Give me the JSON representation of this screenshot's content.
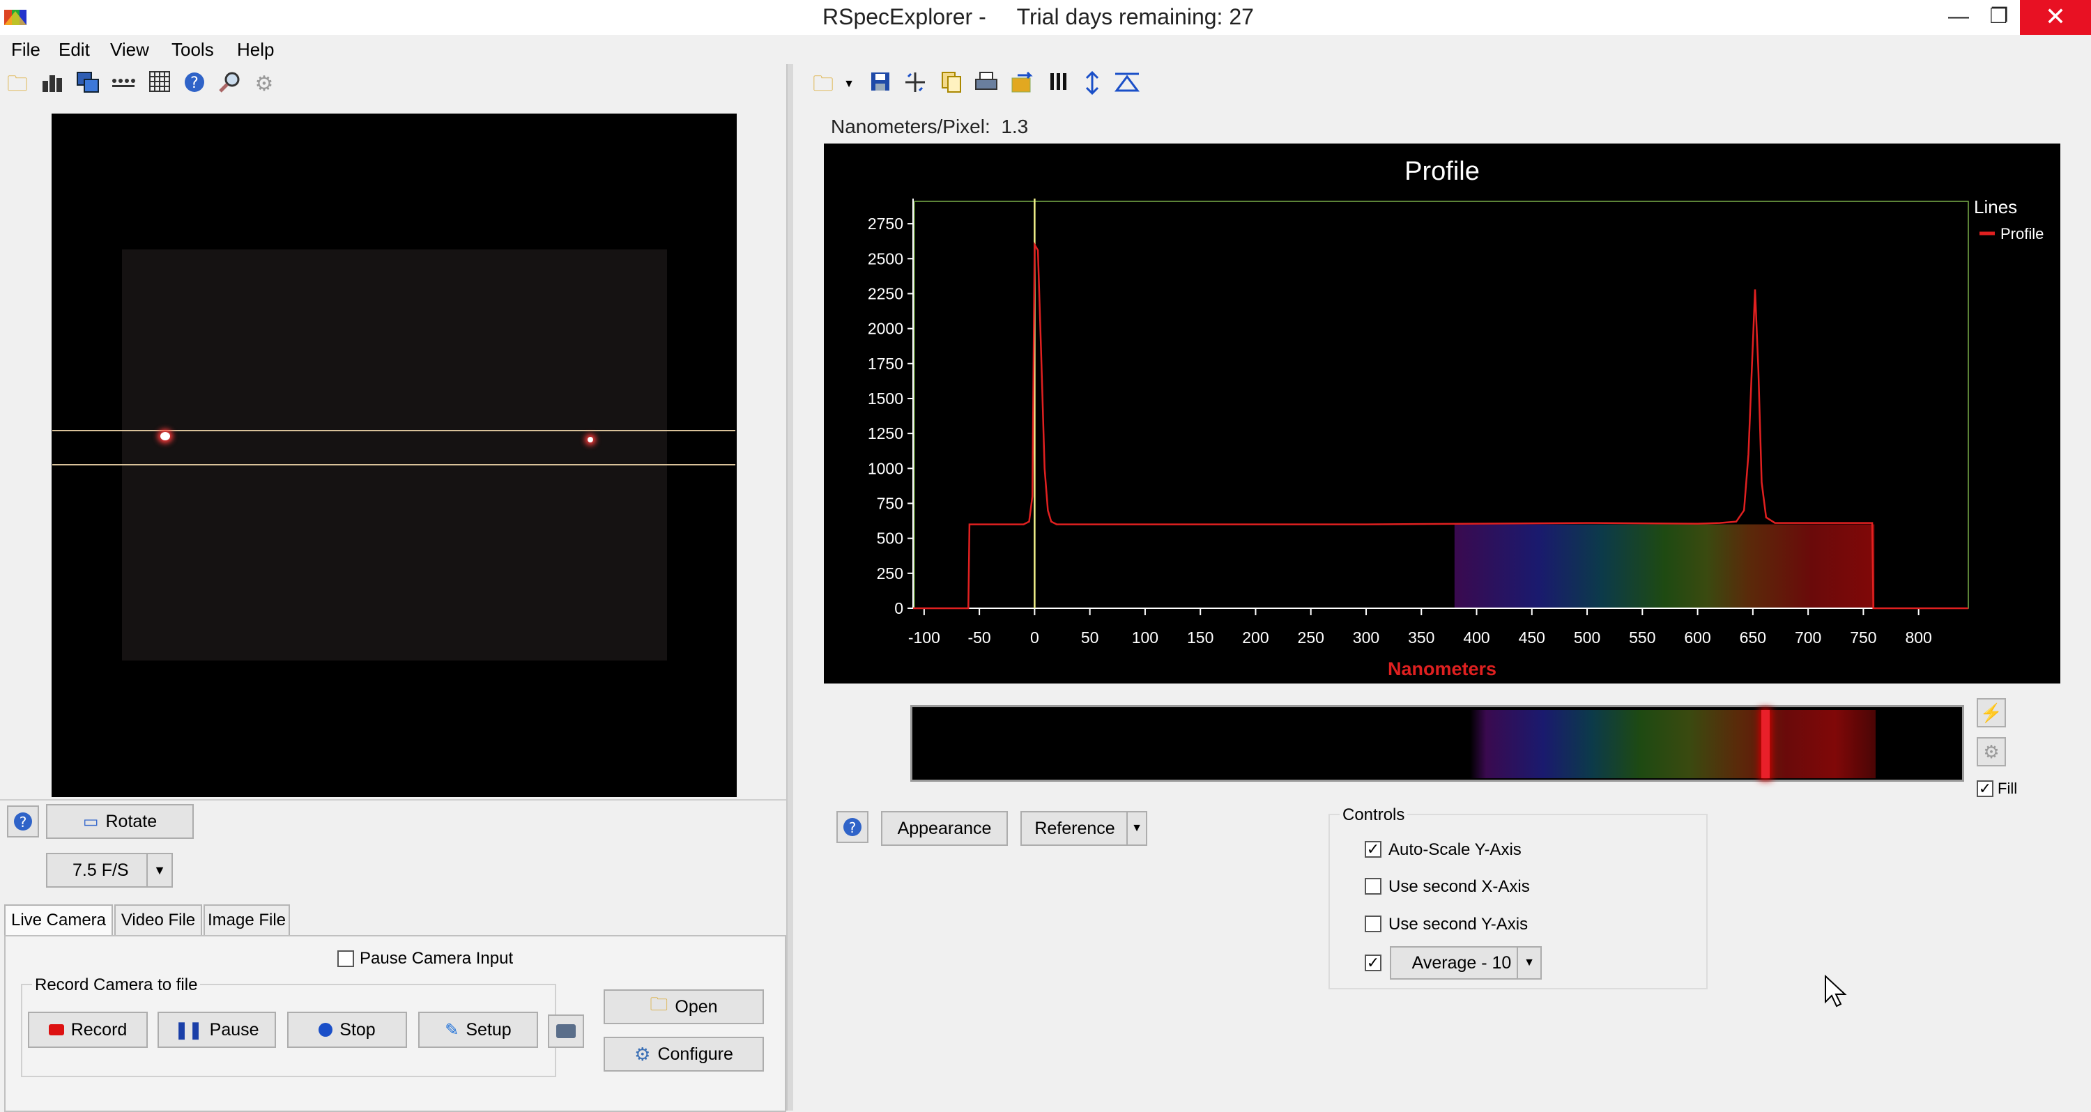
{
  "window": {
    "title": "RSpecExplorer -     Trial days remaining: 27",
    "minimize": "—",
    "restore": "❐",
    "close": "✕"
  },
  "menu": [
    "File",
    "Edit",
    "View",
    "Tools",
    "Help"
  ],
  "left_toolbar_icons": [
    "open-folder-icon",
    "bar-chart-icon",
    "copy-images-icon",
    "dots-icon",
    "grid-icon",
    "help-icon",
    "zoom-icon",
    "settings-icon"
  ],
  "right_toolbar_icons": [
    "open-folder-icon",
    "dropdown-arrow-icon",
    "save-icon",
    "crosshair-icon",
    "copy-icon",
    "print-icon",
    "export-icon",
    "columns-icon",
    "vertical-scale-icon",
    "triangle-icon"
  ],
  "camera_controls": {
    "rotate_label": "Rotate",
    "fps_value": "7.5 F/S"
  },
  "tabs": [
    "Live Camera",
    "Video File",
    "Image File"
  ],
  "pause_camera_label": "Pause Camera Input",
  "record_group": {
    "title": "Record Camera to file",
    "record": "Record",
    "pause": "Pause",
    "stop": "Stop",
    "setup": "Setup"
  },
  "file_buttons": {
    "open": "Open",
    "configure": "Configure"
  },
  "nm_per_pixel": "Nanometers/Pixel:  1.3",
  "chart_data": {
    "type": "line",
    "title": "Profile",
    "xlabel": "Nanometers",
    "ylabel": "",
    "xlim": [
      -110,
      845
    ],
    "ylim": [
      0,
      2900
    ],
    "x_ticks": [
      -100,
      -50,
      0,
      50,
      100,
      150,
      200,
      250,
      300,
      350,
      400,
      450,
      500,
      550,
      600,
      650,
      700,
      750,
      800
    ],
    "y_ticks": [
      0,
      250,
      500,
      750,
      1000,
      1250,
      1500,
      1750,
      2000,
      2250,
      2500,
      2750
    ],
    "legend_title": "Lines",
    "legend_placement": "top-right",
    "series": [
      {
        "name": "Profile",
        "color": "#e02020",
        "x": [
          -110,
          -60,
          -59,
          -10,
          -5,
          -2,
          0,
          3,
          6,
          9,
          12,
          15,
          20,
          30,
          100,
          200,
          300,
          400,
          500,
          600,
          620,
          635,
          642,
          646,
          649,
          652,
          655,
          658,
          662,
          670,
          700,
          758,
          759,
          845
        ],
        "y": [
          0,
          0,
          600,
          600,
          620,
          800,
          2600,
          2560,
          1800,
          1000,
          700,
          620,
          600,
          600,
          600,
          600,
          600,
          605,
          610,
          605,
          610,
          620,
          700,
          1100,
          1700,
          2280,
          1700,
          900,
          650,
          610,
          610,
          610,
          0,
          0
        ]
      }
    ],
    "marker_line_x": 0,
    "grid": false
  },
  "side_icons": {
    "fill_label": "Fill"
  },
  "bottom_buttons": {
    "appearance": "Appearance",
    "reference": "Reference"
  },
  "controls": {
    "title": "Controls",
    "auto_scale": "Auto-Scale Y-Axis",
    "second_x": "Use second X-Axis",
    "second_y": "Use second Y-Axis",
    "average": "Average - 10"
  },
  "colors": {
    "chart_background": "#000000",
    "axis_label": "#e02020",
    "marker_line": "#f2f28a"
  }
}
